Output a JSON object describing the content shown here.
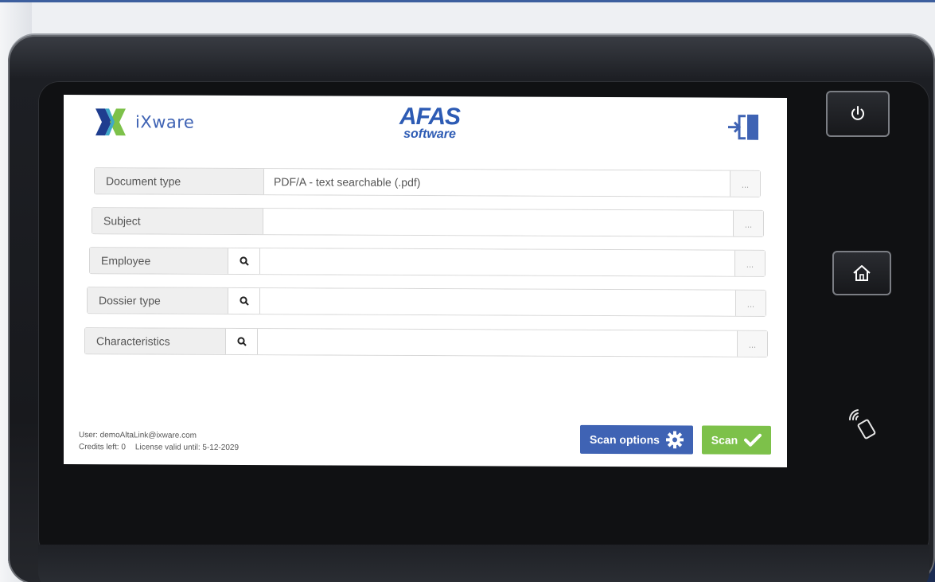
{
  "brand": {
    "ixware_name": "iXware",
    "afas_top": "AFAS",
    "afas_bottom": "software"
  },
  "fields": [
    {
      "label": "Document type",
      "value": "PDF/A - text searchable (.pdf)",
      "more": "...",
      "searchable": false
    },
    {
      "label": "Subject",
      "value": "",
      "more": "...",
      "searchable": false
    },
    {
      "label": "Employee",
      "value": "",
      "more": "...",
      "searchable": true
    },
    {
      "label": "Dossier type",
      "value": "",
      "more": "...",
      "searchable": true
    },
    {
      "label": "Characteristics",
      "value": "",
      "more": "...",
      "searchable": true
    }
  ],
  "footer": {
    "user": "User: demoAltaLink@ixware.com",
    "credits": "Credits left: 0",
    "license": "License valid until: 5-12-2029"
  },
  "buttons": {
    "scan_options": "Scan options",
    "scan": "Scan"
  },
  "colors": {
    "brand_blue": "#3f63b4",
    "scan_green": "#7dc14a",
    "ixware_logo_left": "#1f3d8f",
    "ixware_logo_right": "#7dc14a"
  },
  "icons": {
    "logout": "logout-door-icon",
    "search": "magnifier-icon",
    "gear": "gear-icon",
    "check": "checkmark-icon",
    "power": "power-icon",
    "home": "home-icon",
    "nfc": "nfc-card-icon"
  }
}
